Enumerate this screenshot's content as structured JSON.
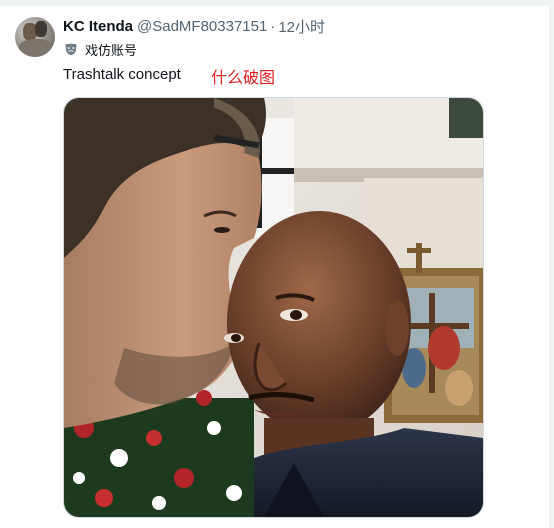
{
  "tweet": {
    "author_name": "KC Itenda",
    "handle": "@SadMF80337151",
    "separator": "·",
    "time": "12小时",
    "badge_text": "戏仿账号",
    "text": "Trashtalk concept",
    "annotation": "什么破图"
  },
  "icons": {
    "badge": "theater-mask-icon"
  },
  "colors": {
    "name": "#0f1419",
    "secondary": "#536471",
    "annotation": "#e0201f",
    "border": "#cfd9de"
  }
}
